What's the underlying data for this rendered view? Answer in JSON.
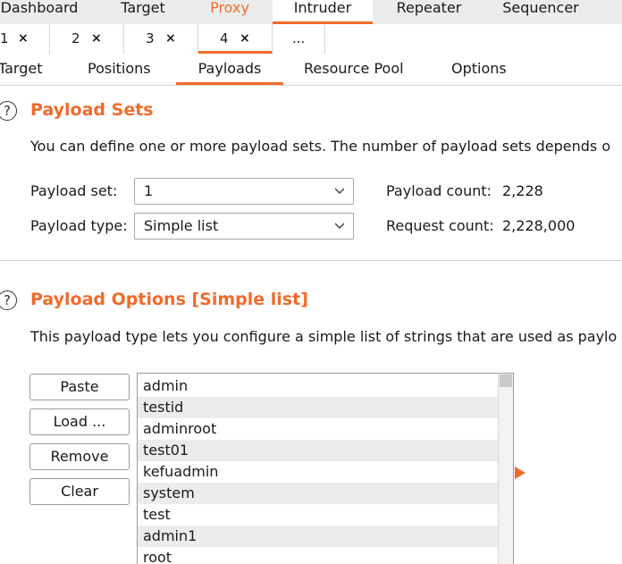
{
  "top_tabs": [
    {
      "label": "Dashboard"
    },
    {
      "label": "Target"
    },
    {
      "label": "Proxy"
    },
    {
      "label": "Intruder"
    },
    {
      "label": "Repeater"
    },
    {
      "label": "Sequencer"
    }
  ],
  "attack_tabs": [
    {
      "label": "1",
      "close": "×"
    },
    {
      "label": "2",
      "close": "×"
    },
    {
      "label": "3",
      "close": "×"
    },
    {
      "label": "4",
      "close": "×"
    },
    {
      "label": "..."
    }
  ],
  "sub_tabs": [
    {
      "label": "Target"
    },
    {
      "label": "Positions"
    },
    {
      "label": "Payloads"
    },
    {
      "label": "Resource Pool"
    },
    {
      "label": "Options"
    }
  ],
  "payload_sets": {
    "help": "?",
    "title": "Payload Sets",
    "description": "You can define one or more payload sets. The number of payload sets depends o",
    "set_label": "Payload set:",
    "set_value": "1",
    "type_label": "Payload type:",
    "type_value": "Simple list",
    "payload_count_label": "Payload count:",
    "payload_count": "2,228",
    "request_count_label": "Request count:",
    "request_count": "2,228,000"
  },
  "payload_options": {
    "help": "?",
    "title": "Payload Options [Simple list]",
    "description": "This payload type lets you configure a simple list of strings that are used as paylo",
    "buttons": {
      "paste": "Paste",
      "load": "Load ...",
      "remove": "Remove",
      "clear": "Clear"
    },
    "items": [
      "admin",
      "testid",
      "adminroot",
      "test01",
      "kefuadmin",
      "system",
      "test",
      "admin1",
      "root"
    ]
  },
  "colors": {
    "accent": "#f26a2a",
    "alt_row": "#ececec",
    "tab_bar": "#ececec"
  },
  "icons": {
    "help": "help-circle-icon",
    "chevron": "chevron-down-icon",
    "arrow": "triangle-right-icon"
  }
}
